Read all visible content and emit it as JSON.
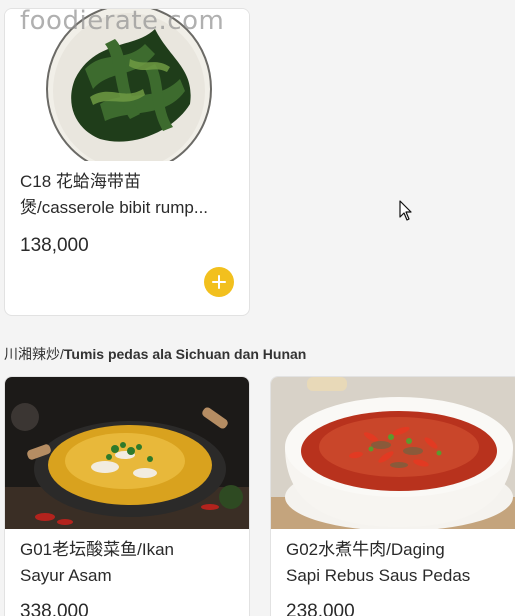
{
  "watermark": "foodierate.com",
  "featured_item": {
    "name_line1": "C18 花蛤海带苗",
    "name_line2": "煲/casserole bibit rump...",
    "price": "138,000"
  },
  "section": {
    "title_zh": "川湘辣炒/",
    "title_id": "Tumis pedas ala Sichuan dan Hunan"
  },
  "items": [
    {
      "name_line1": "G01老坛酸菜鱼/Ikan",
      "name_line2": "Sayur Asam",
      "price": "338,000"
    },
    {
      "name_line1": "G02水煮牛肉/Daging",
      "name_line2": "Sapi Rebus Saus Pedas",
      "price": "238,000"
    }
  ],
  "colors": {
    "accent": "#f2c01e",
    "background": "#f4f4f4",
    "card": "#ffffff",
    "text": "#2a2a2a"
  },
  "icons": {
    "add_button": "plus-icon",
    "cursor": "mouse-pointer-icon"
  }
}
